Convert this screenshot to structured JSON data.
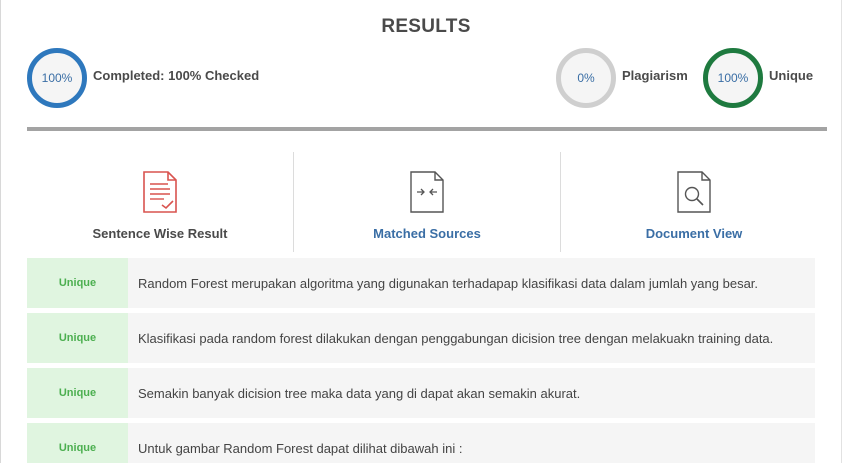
{
  "header": {
    "title": "RESULTS"
  },
  "stats": {
    "completed": {
      "value": "100%",
      "label": "Completed: 100% Checked"
    },
    "plagiarism": {
      "value": "0%",
      "label": "Plagiarism"
    },
    "unique": {
      "value": "100%",
      "label": "Unique"
    }
  },
  "tabs": [
    {
      "label": "Sentence Wise Result",
      "icon": "sentence-report-icon",
      "active": true
    },
    {
      "label": "Matched Sources",
      "icon": "compare-file-icon",
      "active": false
    },
    {
      "label": "Document View",
      "icon": "document-search-icon",
      "active": false
    }
  ],
  "rows": [
    {
      "status": "Unique",
      "text": "Random Forest merupakan algoritma yang digunakan terhadapap klasifikasi data dalam jumlah yang besar."
    },
    {
      "status": "Unique",
      "text": "Klasifikasi pada random forest dilakukan dengan penggabungan dicision tree dengan melakuakn training data."
    },
    {
      "status": "Unique",
      "text": "Semakin banyak dicision tree maka data yang di dapat akan semakin akurat."
    },
    {
      "status": "Unique",
      "text": "Untuk gambar Random Forest dapat dilihat dibawah ini :"
    }
  ],
  "colors": {
    "completed_ring": "#2e78bd",
    "plagiarism_ring": "#cfcfcf",
    "unique_ring": "#1e7a3f",
    "unique_badge_bg": "#e0f5e0",
    "unique_badge_text": "#4caf50",
    "link": "#3a6ea5",
    "active_icon": "#d9534f"
  }
}
